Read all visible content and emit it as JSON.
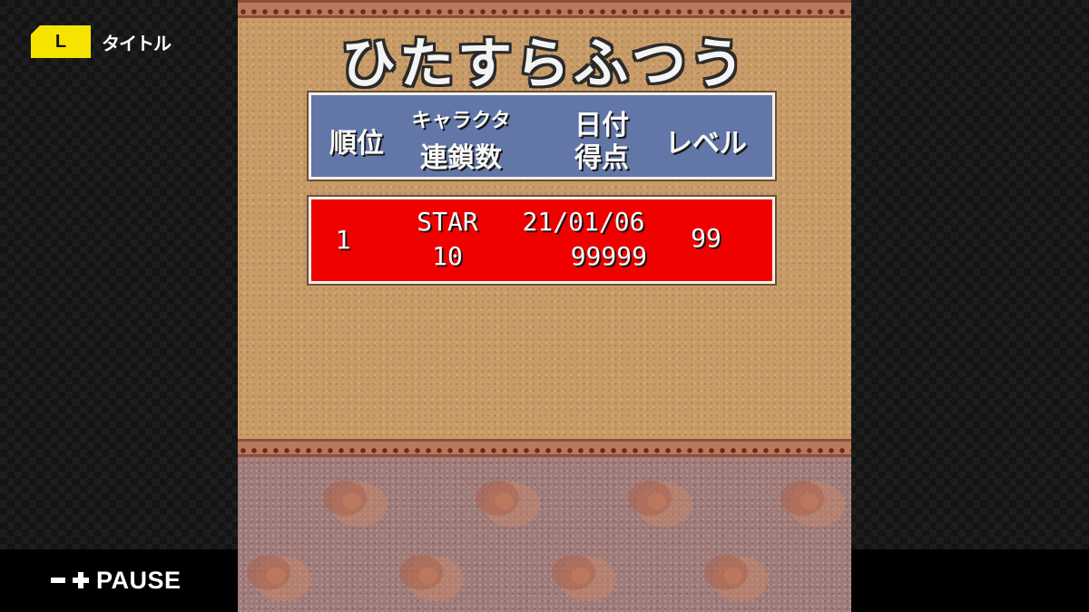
{
  "overlay": {
    "l_button_label": "L",
    "l_action_label": "タイトル",
    "pause_label": "PAUSE"
  },
  "game": {
    "mode_title": "ひたすらふつう",
    "headers": {
      "rank": "順位",
      "character": "キャラクター",
      "chain": "連鎖数",
      "date": "日付",
      "score": "得点",
      "level": "レベル"
    },
    "entries": [
      {
        "rank": "1",
        "character": "STAR",
        "chain": "10",
        "date": "21/01/06",
        "score": "99999",
        "level": "99"
      }
    ]
  },
  "colors": {
    "header_panel": "#6277a8",
    "entry_panel": "#f10000",
    "l_badge": "#f4e400",
    "wall": "#c89c68",
    "floor": "#9e7b78"
  }
}
